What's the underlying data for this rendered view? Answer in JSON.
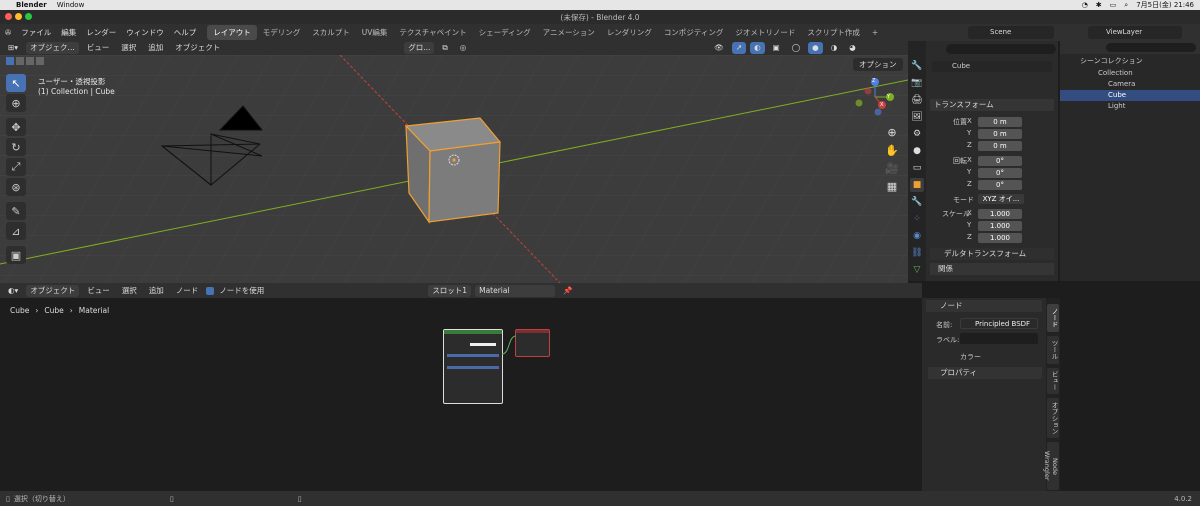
{
  "macos": {
    "app": "Blender",
    "menu": [
      "Window"
    ],
    "clock": "7月5日(金) 21:46"
  },
  "window": {
    "title": "(未保存) - Blender 4.0"
  },
  "topbar": {
    "menus": [
      "ファイル",
      "編集",
      "レンダー",
      "ウィンドウ",
      "ヘルプ"
    ],
    "workspaces": [
      "レイアウト",
      "モデリング",
      "スカルプト",
      "UV編集",
      "テクスチャペイント",
      "シェーディング",
      "アニメーション",
      "レンダリング",
      "コンポジティング",
      "ジオメトリノード",
      "スクリプト作成"
    ],
    "active_workspace": "レイアウト",
    "scene": "Scene",
    "view_layer": "ViewLayer"
  },
  "viewport": {
    "mode": "オブジェク...",
    "menus": [
      "ビュー",
      "選択",
      "追加",
      "オブジェクト"
    ],
    "transform": "グロ...",
    "options": "オプション",
    "info_line1": "ユーザー・透視投影",
    "info_line2": "(1) Collection | Cube",
    "gizmo": {
      "x": "X",
      "y": "Y",
      "z": "Z"
    },
    "colors": {
      "bg": "#3c3c3c",
      "selection": "#f0a030",
      "x_axis": "#c84040",
      "y_axis": "#80b020"
    }
  },
  "properties": {
    "object_name": "Cube",
    "transform_label": "トランスフォーム",
    "location_label": "位置",
    "rotation_label": "回転",
    "mode_label": "モード",
    "scale_label": "スケール",
    "axis_x": "X",
    "axis_y": "Y",
    "axis_z": "Z",
    "location": [
      "0 m",
      "0 m",
      "0 m"
    ],
    "rotation": [
      "0°",
      "0°",
      "0°"
    ],
    "mode_value": "XYZ オイ...",
    "scale": [
      "1.000",
      "1.000",
      "1.000"
    ],
    "delta": "デルタトランスフォーム",
    "relations": "関係"
  },
  "outliner": {
    "scene_collection": "シーンコレクション",
    "items": [
      "Collection",
      "Camera",
      "Cube",
      "Light"
    ]
  },
  "node_editor": {
    "mode": "オブジェクト",
    "menus": [
      "ビュー",
      "選択",
      "追加",
      "ノード"
    ],
    "use_nodes": "ノードを使用",
    "slot": "スロット1",
    "material": "Material",
    "breadcrumb": [
      "Cube",
      "Cube",
      "Material"
    ]
  },
  "node_sidebar": {
    "section": "ノード",
    "name_label": "名前:",
    "name_value": "Principled BSDF",
    "label_label": "ラベル:",
    "color_label": "カラー",
    "props_label": "プロパティ",
    "tabs": [
      "ノード",
      "ツール",
      "ビュー",
      "オプション",
      "Node Wrangler"
    ]
  },
  "statusbar": {
    "select": "選択（切り替え）",
    "version": "4.0.2"
  }
}
